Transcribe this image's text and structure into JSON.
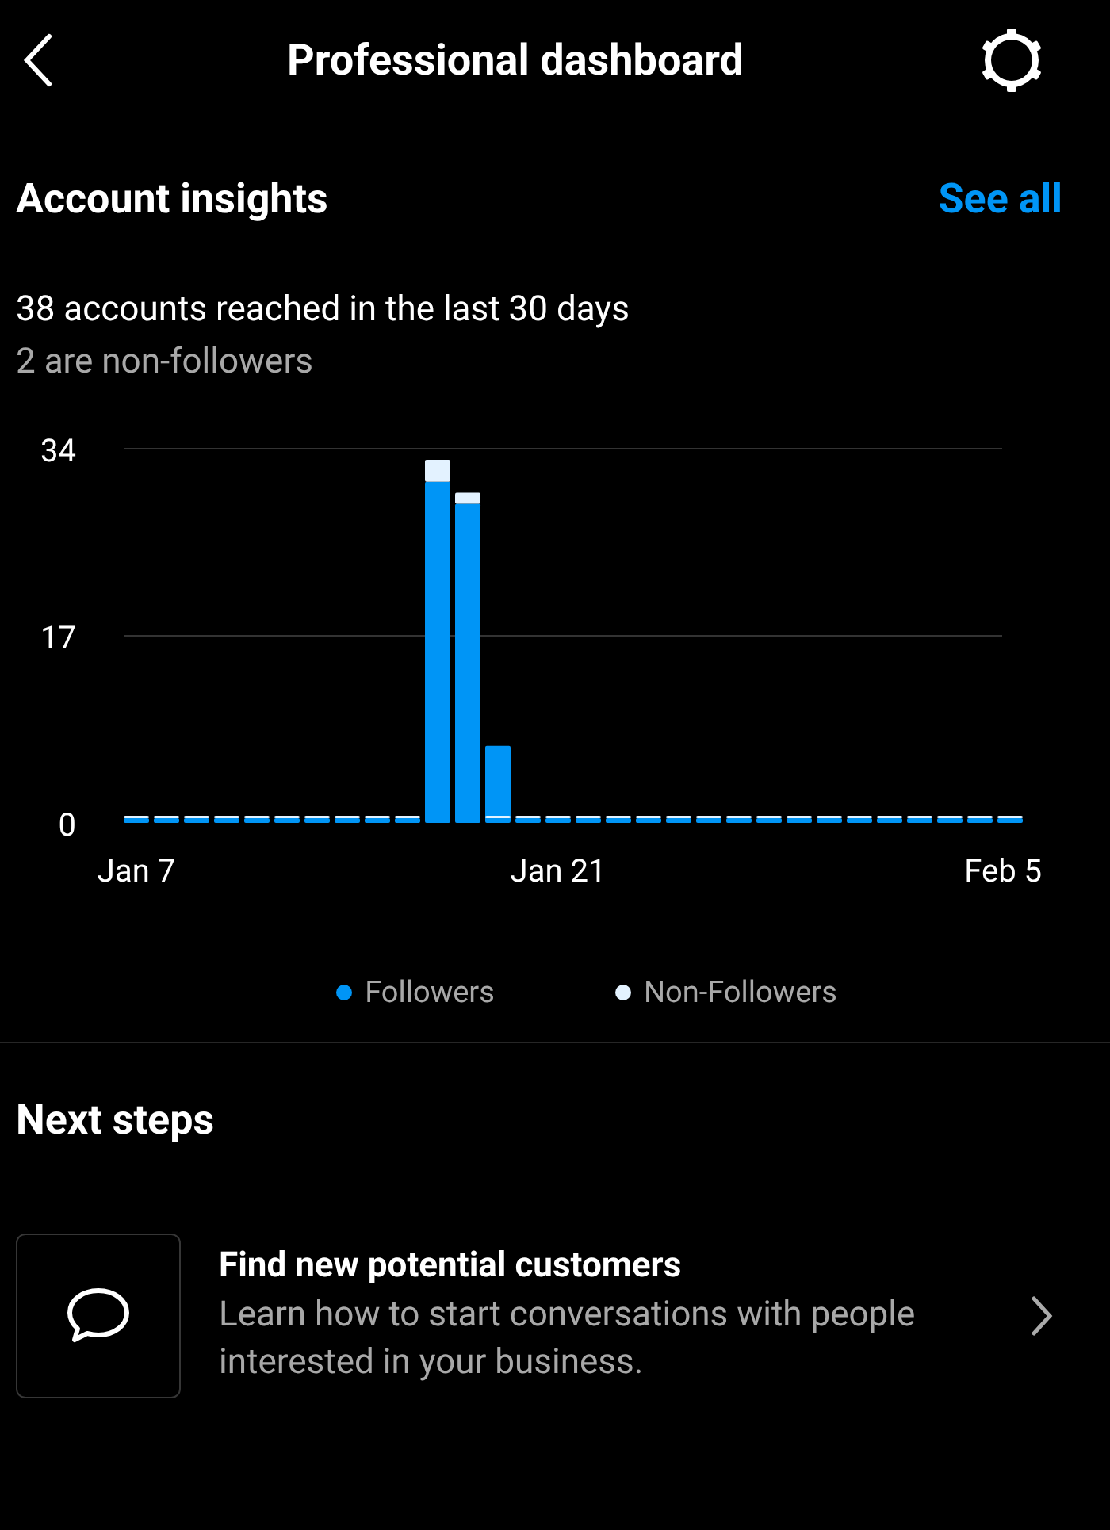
{
  "header": {
    "title": "Professional dashboard"
  },
  "insights": {
    "title": "Account insights",
    "see_all": "See all",
    "summary": "38 accounts reached in the last 30 days",
    "subtext": "2 are non-followers",
    "chart_data": {
      "type": "bar",
      "stacked": true,
      "legend": "bottom",
      "categories": [
        "Jan 7",
        null,
        null,
        null,
        null,
        null,
        null,
        null,
        null,
        null,
        null,
        null,
        null,
        null,
        "Jan 21",
        null,
        null,
        null,
        null,
        null,
        null,
        null,
        null,
        null,
        null,
        null,
        null,
        null,
        null,
        "Feb 5"
      ],
      "yticks": [
        0,
        17,
        34
      ],
      "ylim": [
        0,
        34
      ],
      "series": [
        {
          "name": "Followers",
          "color": "#0095f6",
          "values": [
            0,
            0,
            0,
            0,
            0,
            0,
            0,
            0,
            0,
            0,
            31,
            29,
            7,
            0,
            0,
            0,
            0,
            0,
            0,
            0,
            0,
            0,
            0,
            0,
            0,
            0,
            0,
            0,
            0,
            0
          ]
        },
        {
          "name": "Non-Followers",
          "color": "#e3f2ff",
          "values": [
            0,
            0,
            0,
            0,
            0,
            0,
            0,
            0,
            0,
            0,
            2,
            1,
            0,
            0,
            0,
            0,
            0,
            0,
            0,
            0,
            0,
            0,
            0,
            0,
            0,
            0,
            0,
            0,
            0,
            0
          ]
        }
      ]
    }
  },
  "next_steps": {
    "title": "Next steps",
    "items": [
      {
        "title": "Find new potential customers",
        "description": "Learn how to start conversations with people interested in your business."
      }
    ]
  }
}
